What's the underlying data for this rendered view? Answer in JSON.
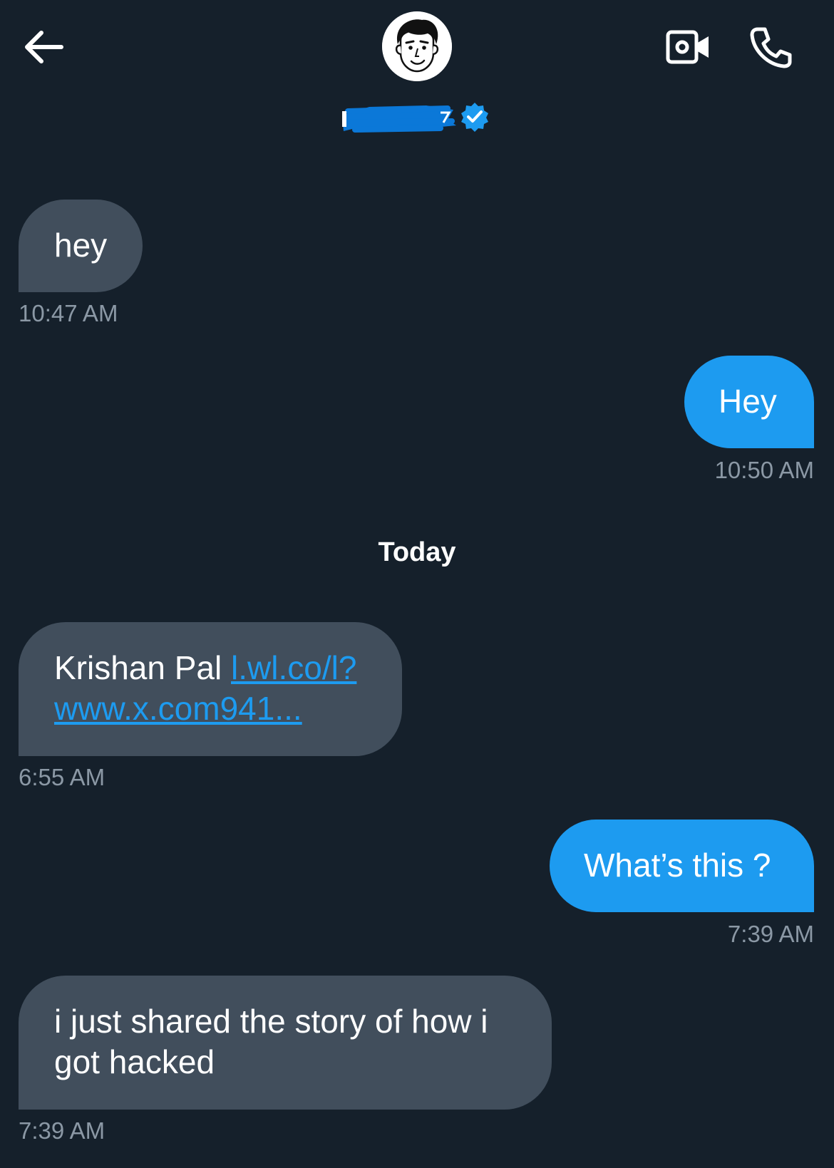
{
  "header": {
    "back_icon": "arrow-left-icon",
    "avatar_icon": "avatar-illustration",
    "verified_icon": "verified-badge-icon",
    "video_icon": "video-call-icon",
    "phone_icon": "phone-call-icon"
  },
  "messages": [
    {
      "direction": "incoming",
      "text": "hey",
      "time": "10:47 AM"
    },
    {
      "direction": "outgoing",
      "text": "Hey",
      "time": "10:50 AM"
    },
    {
      "direction": "incoming",
      "text_prefix": "Krishan Pal ",
      "link_line1": "l.wl.co/l?",
      "link_line2": "www.x.com941...",
      "time": "6:55 AM"
    },
    {
      "direction": "outgoing",
      "text": "What’s this ?",
      "time": "7:39 AM"
    },
    {
      "direction": "incoming",
      "text_line1": "i just shared the story of how i",
      "text_line2": "got hacked",
      "time": "7:39 AM"
    }
  ],
  "day_separator": "Today",
  "colors": {
    "background": "#15202b",
    "incoming_bubble": "#414e5c",
    "outgoing_bubble": "#1d9bf0",
    "link": "#1d9bf0",
    "timestamp": "#8b98a5"
  }
}
